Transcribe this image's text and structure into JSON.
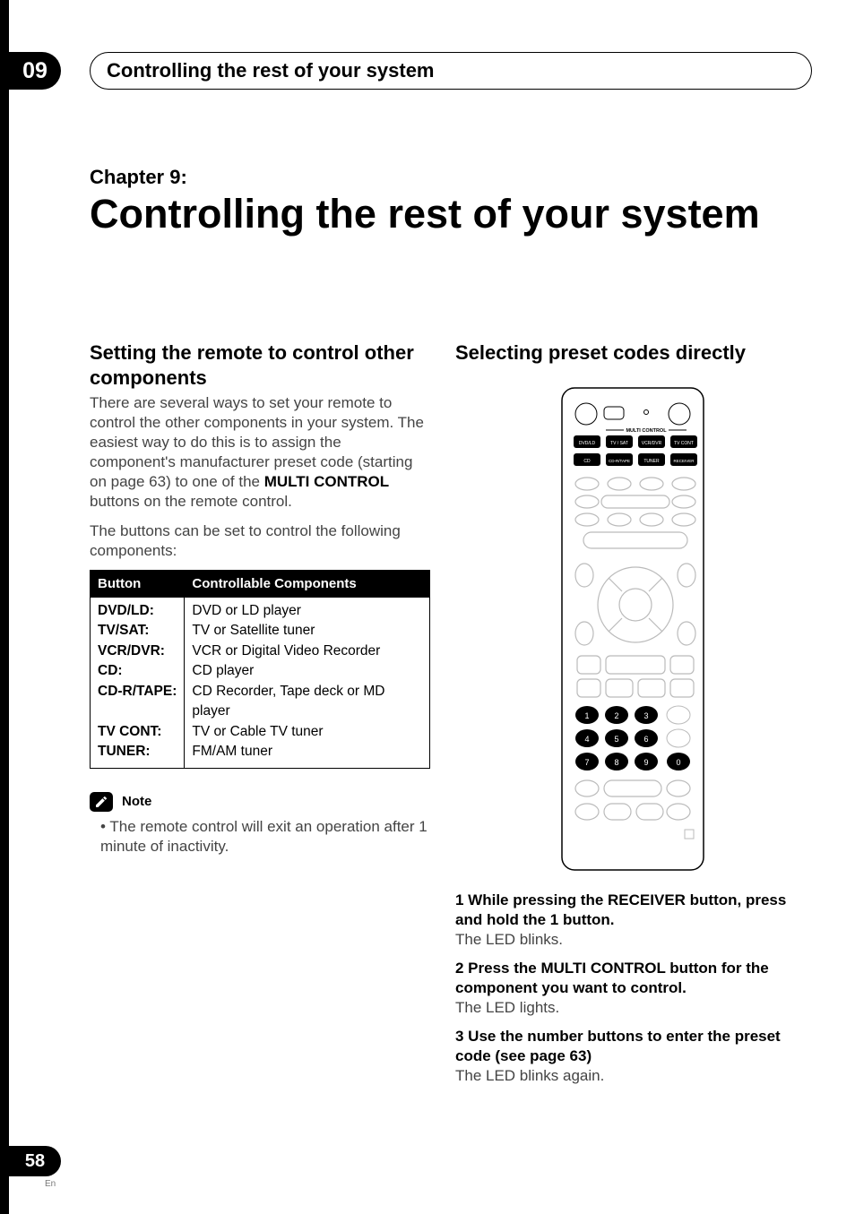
{
  "chapter_tab": "09",
  "header_title": "Controlling the rest of your system",
  "chapter_label": "Chapter 9:",
  "big_title": "Controlling the rest of your system",
  "left": {
    "heading": "Setting the remote to control other components",
    "p1_a": "There are several ways to set your remote to control the other components in your system. The easiest way to do this is to assign the component's manufacturer preset code (starting on page 63) to one of the ",
    "p1_b": "MULTI CONTROL",
    "p1_c": " buttons on the remote control.",
    "p2": "The buttons can be set to control the following components:",
    "table": {
      "h1": "Button",
      "h2": "Controllable Components",
      "rows": [
        {
          "btn": "DVD/LD:",
          "comp": "DVD or LD player"
        },
        {
          "btn": "TV/SAT:",
          "comp": "TV or Satellite tuner"
        },
        {
          "btn": "VCR/DVR:",
          "comp": "VCR or Digital Video Recorder"
        },
        {
          "btn": "CD:",
          "comp": "CD player"
        },
        {
          "btn": "CD-R/TAPE:",
          "comp": "CD Recorder, Tape deck or MD player"
        },
        {
          "btn": "TV CONT:",
          "comp": "TV or Cable TV tuner"
        },
        {
          "btn": "TUNER:",
          "comp": "FM/AM tuner"
        }
      ]
    },
    "note_label": "Note",
    "note_text": "The remote control will exit an operation after 1 minute of inactivity."
  },
  "right": {
    "heading": "Selecting preset codes directly",
    "remote": {
      "multi_label": "MULTI CONTROL",
      "buttons": [
        "DVD/LD",
        "TV / SAT",
        "VCR/DVR",
        "TV CONT",
        "CD",
        "CD-R/TAPE",
        "TUNER",
        "RECEIVER"
      ],
      "numbers": [
        "1",
        "2",
        "3",
        "4",
        "5",
        "6",
        "7",
        "8",
        "9",
        "0"
      ]
    },
    "step1_lead": "1   While pressing the RECEIVER button, press and hold the 1 button.",
    "step1_sub": "The LED blinks.",
    "step2_lead": "2   Press the MULTI CONTROL button for the component you want to control.",
    "step2_sub": "The LED lights.",
    "step3_lead": "3   Use the number buttons to enter the preset code (see page 63)",
    "step3_sub": "The LED blinks again."
  },
  "page_number": "58",
  "lang": "En"
}
